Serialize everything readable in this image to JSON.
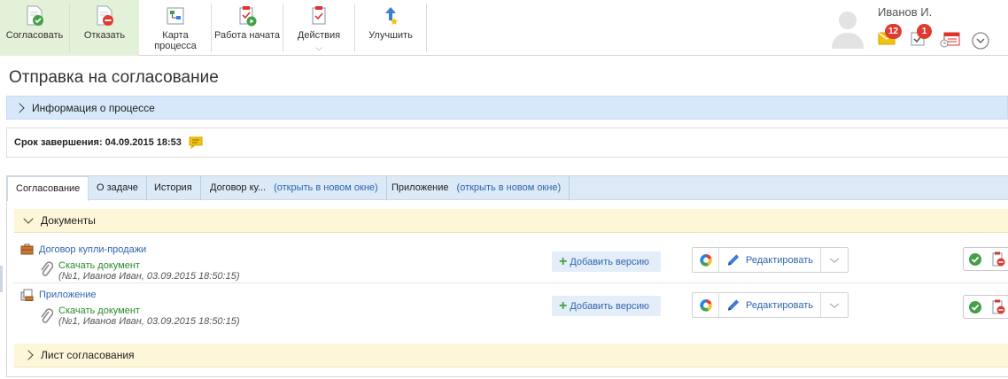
{
  "toolbar": {
    "approve_label": "Согласовать",
    "reject_label": "Отказать",
    "process_map_line1": "Карта",
    "process_map_line2": "процесса",
    "work_started_label": "Работа начата",
    "actions_label": "Действия",
    "improve_label": "Улучшить"
  },
  "user": {
    "name": "Иванов И.",
    "mail_count": "12",
    "tasks_count": "1"
  },
  "page": {
    "title": "Отправка на согласование"
  },
  "info_bar": {
    "label": "Информация о процессе"
  },
  "deadline": {
    "text": "Срок завершения: 04.09.2015 18:53"
  },
  "tabs": [
    {
      "label": "Согласование"
    },
    {
      "label": "О задаче"
    },
    {
      "label": "История"
    },
    {
      "label": "Договор ку...",
      "link": "(открыть в новом окне)"
    },
    {
      "label": "Приложение",
      "link": "(открыть в новом окне)"
    }
  ],
  "documents_section": {
    "label": "Документы",
    "items": [
      {
        "title": "Договор купли-продажи",
        "download": "Скачать документ",
        "meta": "(№1, Иванов Иван, 03.09.2015 18:50:15)",
        "add_version": "Добавить версию",
        "edit": "Редактировать"
      },
      {
        "title": "Приложение",
        "download": "Скачать документ",
        "meta": "(№1, Иванов Иван, 03.09.2015 18:50:15)",
        "add_version": "Добавить версию",
        "edit": "Редактировать"
      }
    ]
  },
  "approval_sheet": {
    "label": "Лист согласования"
  },
  "colors": {
    "accent_link": "#2f65b0",
    "approve_bg": "#e4f1d9",
    "info_bar_bg": "#d7e8fa",
    "section_bg": "#fdf6d8",
    "badge_red": "#e03b2f",
    "download_green": "#2a8a2a"
  }
}
